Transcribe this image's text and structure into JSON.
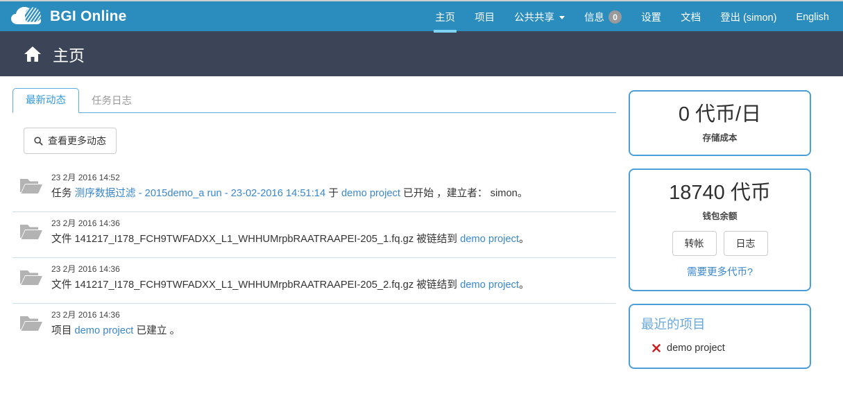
{
  "colors": {
    "brand_blue": "#2b8cbe",
    "dark_slate": "#3b4557",
    "link_blue": "#3a87cd",
    "panel_border": "#4a9fd8",
    "accent_underline": "#7fd3f2",
    "badge_gray": "#9a9a9a",
    "project_x_red": "#cc2222"
  },
  "header": {
    "logo_icon": "cloud-icon",
    "brand": "BGI Online",
    "nav": [
      {
        "label": "主页",
        "active": true,
        "icon": null,
        "badge": null
      },
      {
        "label": "项目",
        "active": false,
        "icon": null,
        "badge": null
      },
      {
        "label": "公共共享",
        "active": false,
        "icon": "chevron-down-icon",
        "badge": null
      },
      {
        "label": "信息",
        "active": false,
        "icon": null,
        "badge": "0"
      },
      {
        "label": "设置",
        "active": false,
        "icon": null,
        "badge": null
      },
      {
        "label": "文档",
        "active": false,
        "icon": null,
        "badge": null
      },
      {
        "label": "登出 (simon)",
        "active": false,
        "icon": null,
        "badge": null
      },
      {
        "label": "English",
        "active": false,
        "icon": null,
        "badge": null
      }
    ]
  },
  "titlebar": {
    "icon": "home-icon",
    "title": "主页"
  },
  "tabs": [
    {
      "label": "最新动态",
      "active": true
    },
    {
      "label": "任务日志",
      "active": false
    }
  ],
  "more_button": {
    "label": "查看更多动态",
    "icon": "search-icon"
  },
  "feed": [
    {
      "icon": "folder-icon",
      "time": "23 2月 2016 14:52",
      "parts": [
        {
          "text": "任务 ",
          "link": false
        },
        {
          "text": "测序数据过滤 - 2015demo_a run - 23-02-2016 14:51:14",
          "link": true
        },
        {
          "text": " 于 ",
          "link": false
        },
        {
          "text": "demo project",
          "link": true
        },
        {
          "text": " 已开始 ，建立者： simon。",
          "link": false
        }
      ]
    },
    {
      "icon": "folder-icon",
      "time": "23 2月 2016 14:36",
      "parts": [
        {
          "text": "文件 141217_I178_FCH9TWFADXX_L1_WHHUMrpbRAATRAAPEI-205_1.fq.gz 被链结到 ",
          "link": false
        },
        {
          "text": "demo project",
          "link": true
        },
        {
          "text": "。",
          "link": false
        }
      ]
    },
    {
      "icon": "folder-icon",
      "time": "23 2月 2016 14:36",
      "parts": [
        {
          "text": "文件 141217_I178_FCH9TWFADXX_L1_WHHUMrpbRAATRAAPEI-205_2.fq.gz 被链结到 ",
          "link": false
        },
        {
          "text": "demo project",
          "link": true
        },
        {
          "text": "。",
          "link": false
        }
      ]
    },
    {
      "icon": "folder-icon",
      "time": "23 2月 2016 14:36",
      "parts": [
        {
          "text": "项目 ",
          "link": false
        },
        {
          "text": "demo project",
          "link": true
        },
        {
          "text": " 已建立 。",
          "link": false
        }
      ]
    }
  ],
  "sidebar": {
    "storage_panel": {
      "value": "0 代币/日",
      "label": "存储成本"
    },
    "wallet_panel": {
      "value": "18740 代币",
      "label": "钱包余额",
      "transfer_button": "转帐",
      "log_button": "日志",
      "more_link": "需要更多代币?"
    },
    "projects_panel": {
      "heading": "最近的项目",
      "items": [
        {
          "icon": "x-icon",
          "name": "demo project"
        }
      ]
    }
  }
}
